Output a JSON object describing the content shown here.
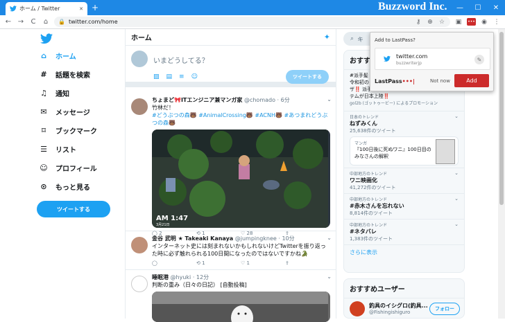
{
  "browser": {
    "tab_title": "ホーム / Twitter",
    "new_tab": "+",
    "url": "twitter.com/home",
    "back": "←",
    "forward": "→",
    "reload": "C",
    "home": "⌂",
    "minimize": "—",
    "maximize": "☐",
    "close": "✕"
  },
  "nav": {
    "items": [
      {
        "label": "ホーム",
        "icon": "home-icon"
      },
      {
        "label": "話題を検索",
        "icon": "hashtag-icon"
      },
      {
        "label": "通知",
        "icon": "bell-icon"
      },
      {
        "label": "メッセージ",
        "icon": "mail-icon"
      },
      {
        "label": "ブックマーク",
        "icon": "bookmark-icon"
      },
      {
        "label": "リスト",
        "icon": "list-icon"
      },
      {
        "label": "プロフィール",
        "icon": "avatar-icon"
      },
      {
        "label": "もっと見る",
        "icon": "more-icon"
      }
    ],
    "tweet_button": "ツイートする",
    "accent": "#1da1f2"
  },
  "timeline": {
    "header": "ホーム",
    "compose_placeholder": "いまどうしてる？",
    "compose_button": "ツイートする",
    "tweets": [
      {
        "name": "ちょまど🎀ITエンジニア兼マンガ家",
        "handle": "@chomado · 6分",
        "text": "竹林だ！",
        "tags": "#どうぶつの森🐻 #AnimalCrossing🐻 #ACNH🐻 #あつまれどうぶつの森🐻",
        "media_time": "AM 1:47",
        "media_date": "3月21日",
        "replies": "2",
        "retweets": "1",
        "likes": "28"
      },
      {
        "name": "金谷 武明 ★ Takeaki Kanaya",
        "handle": "@jumpingknee · 10分",
        "text": "インターネット史には刻まれないかもしれないけどTwitterを振り返った時に必ず触れられる100日間になったのではないですかね🐊",
        "replies": "",
        "retweets": "1",
        "likes": "1"
      },
      {
        "name": "睡眠港",
        "handle": "@hyuki · 12分",
        "text": "判断の重み（日々の日記） [自動投稿]"
      }
    ]
  },
  "sidebar": {
    "search_placeholder": "キ",
    "trends_title": "おすす",
    "promo_lines": [
      "#派手髪",
      "令和初の",
      "ザ‼️ 派手",
      "テムが日本上陸‼️"
    ],
    "promo_by": "gol2b (ゴットゥービー) によるプロモーション",
    "trends": [
      {
        "context": "日本のトレンド",
        "name": "ねずみくん",
        "count": "25,638件のツイート"
      },
      {
        "context": "中部地方のトレンド",
        "name": "ワニ映画化",
        "count": "41,272件のツイート"
      },
      {
        "context": "中部地方のトレンド",
        "name": "#赤木さんを忘れない",
        "count": "8,814件のツイート"
      },
      {
        "context": "中部地方のトレンド",
        "name": "#ネタバレ",
        "count": "1,383件のツイート"
      }
    ],
    "card": {
      "category": "マンガ",
      "text": "『100日後に死ぬワニ』100日目のみなさんの解釈"
    },
    "show_more": "さらに表示",
    "recommend_title": "おすすめユーザー",
    "recommend_user": {
      "name": "釣具のイシグロ(釣具...",
      "handle": "@Fishingishiguro",
      "button": "フォロー"
    }
  },
  "lastpass": {
    "header": "Add to LastPass?",
    "site": "twitter.com",
    "user": "buzzwriterjp",
    "brand": "LastPass",
    "brand_dots": "•••|",
    "not_now": "Not now",
    "add": "Add"
  },
  "watermark": "Buzzword Inc."
}
